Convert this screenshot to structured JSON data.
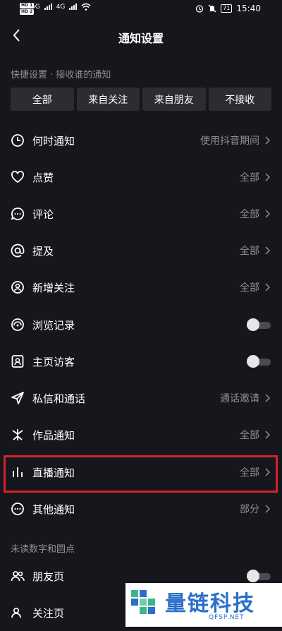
{
  "status_bar": {
    "time": "15:40",
    "battery": "71",
    "hd1": "HD 1",
    "hd2": "HD 2",
    "net1": "5G",
    "net2": "4G"
  },
  "nav": {
    "title": "通知设置"
  },
  "quick": {
    "header": "快捷设置 · 接收谁的通知",
    "buttons": [
      "全部",
      "来自关注",
      "来自朋友",
      "不接收"
    ]
  },
  "items": [
    {
      "label": "何时通知",
      "value": "使用抖音期间",
      "icon": "clock-icon"
    },
    {
      "label": "点赞",
      "value": "全部",
      "icon": "heart-icon"
    },
    {
      "label": "评论",
      "value": "全部",
      "icon": "comment-icon"
    },
    {
      "label": "提及",
      "value": "全部",
      "icon": "at-icon"
    },
    {
      "label": "新增关注",
      "value": "全部",
      "icon": "user-circle-icon"
    },
    {
      "label": "浏览记录",
      "toggle": false,
      "icon": "eye-icon"
    },
    {
      "label": "主页访客",
      "toggle": false,
      "icon": "person-card-icon"
    },
    {
      "label": "私信和通话",
      "value": "通话邀请",
      "icon": "send-icon"
    },
    {
      "label": "作品通知",
      "value": "全部",
      "icon": "sparkle-icon"
    },
    {
      "label": "直播通知",
      "value": "全部",
      "icon": "bars-icon"
    },
    {
      "label": "其他通知",
      "value": "部分",
      "icon": "more-icon"
    }
  ],
  "section2": {
    "header": "未读数字和圆点",
    "items": [
      {
        "label": "朋友页",
        "toggle": false,
        "icon": "friends-icon"
      },
      {
        "label": "关注页",
        "icon": "follow-icon"
      }
    ]
  },
  "watermark": {
    "text": "量链科技",
    "sub": "QFSP.NET"
  },
  "colors": {
    "background": "#16171d",
    "highlight": "#d5222b",
    "muted": "#8f8f96",
    "button_bg": "#2c2d33"
  }
}
